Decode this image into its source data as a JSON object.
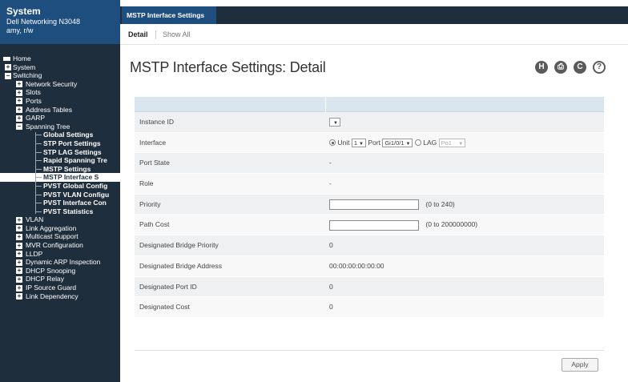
{
  "system": {
    "title": "System",
    "device": "Dell Networking N3048",
    "user": "amy, r/w"
  },
  "tabs": {
    "active": "MSTP Interface Settings",
    "sub": [
      "Detail",
      "Show All"
    ]
  },
  "page_title": "MSTP Interface Settings: Detail",
  "toolbar": {
    "icons": [
      "help-h-icon",
      "print-icon",
      "refresh-icon",
      "question-icon"
    ],
    "glyphs": {
      "h": "H",
      "print": "⎙",
      "refresh": "C",
      "help": "?"
    }
  },
  "nav": [
    {
      "label": "Home",
      "level": 0,
      "box": "",
      "icon": "home-icon"
    },
    {
      "label": "System",
      "level": 0,
      "box": "+"
    },
    {
      "label": "Switching",
      "level": 0,
      "box": "−"
    },
    {
      "label": "Network Security",
      "level": 1,
      "box": "+"
    },
    {
      "label": "Slots",
      "level": 1,
      "box": "+"
    },
    {
      "label": "Ports",
      "level": 1,
      "box": "+"
    },
    {
      "label": "Address Tables",
      "level": 1,
      "box": "+"
    },
    {
      "label": "GARP",
      "level": 1,
      "box": "+"
    },
    {
      "label": "Spanning Tree",
      "level": 1,
      "box": "−"
    },
    {
      "label": "Global Settings",
      "level": 2
    },
    {
      "label": "STP Port Settings",
      "level": 2
    },
    {
      "label": "STP LAG Settings",
      "level": 2
    },
    {
      "label": "Rapid Spanning Tre",
      "level": 2
    },
    {
      "label": "MSTP Settings",
      "level": 2
    },
    {
      "label": "MSTP Interface S",
      "level": 2,
      "selected": true
    },
    {
      "label": "PVST Global Config",
      "level": 2
    },
    {
      "label": "PVST VLAN Configu",
      "level": 2
    },
    {
      "label": "PVST Interface Con",
      "level": 2
    },
    {
      "label": "PVST Statistics",
      "level": 2
    },
    {
      "label": "VLAN",
      "level": 1,
      "box": "+"
    },
    {
      "label": "Link Aggregation",
      "level": 1,
      "box": "+"
    },
    {
      "label": "Multicast Support",
      "level": 1,
      "box": "+"
    },
    {
      "label": "MVR Configuration",
      "level": 1,
      "box": "+"
    },
    {
      "label": "LLDP",
      "level": 1,
      "box": "+"
    },
    {
      "label": "Dynamic ARP Inspection",
      "level": 1,
      "box": "+"
    },
    {
      "label": "DHCP Snooping",
      "level": 1,
      "box": "+"
    },
    {
      "label": "DHCP Relay",
      "level": 1,
      "box": "+"
    },
    {
      "label": "IP Source Guard",
      "level": 1,
      "box": "+"
    },
    {
      "label": "Link Dependency",
      "level": 1,
      "box": "+"
    }
  ],
  "form": {
    "instance_id": {
      "label": "Instance ID",
      "value": ""
    },
    "interface": {
      "label": "Interface",
      "unit_label": "Unit",
      "unit_value": "1",
      "port_label": "Port",
      "port_value": "Gi1/0/1",
      "lag_label": "LAG",
      "lag_value": "Po1"
    },
    "port_state": {
      "label": "Port State",
      "value": "-"
    },
    "role": {
      "label": "Role",
      "value": "-"
    },
    "priority": {
      "label": "Priority",
      "value": "",
      "hint": "(0 to 240)"
    },
    "path_cost": {
      "label": "Path Cost",
      "value": "",
      "hint": "(0 to 200000000)"
    },
    "designated_bridge_priority": {
      "label": "Designated Bridge Priority",
      "value": "0"
    },
    "designated_bridge_address": {
      "label": "Designated Bridge Address",
      "value": "00:00:00:00:00:00"
    },
    "designated_port_id": {
      "label": "Designated Port ID",
      "value": "0"
    },
    "designated_cost": {
      "label": "Designated Cost",
      "value": "0"
    }
  },
  "apply_label": "Apply",
  "caret": "▼"
}
